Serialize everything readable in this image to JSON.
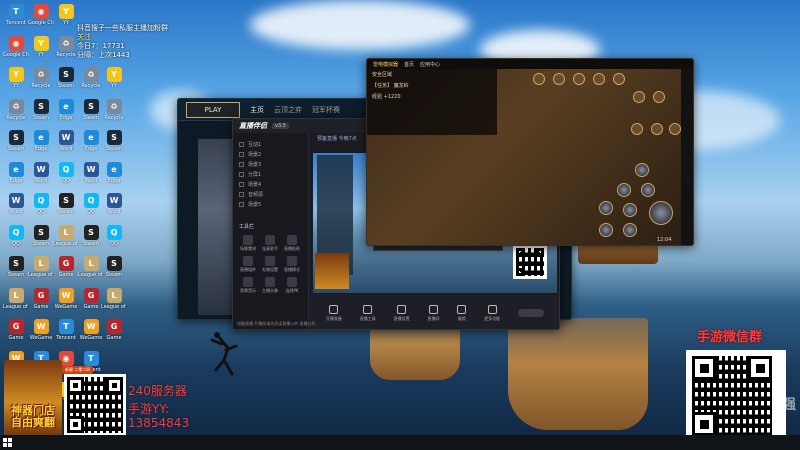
{
  "overlay": {
    "line1": "抖音搜子一些私服主播加粉群",
    "line2": "关注",
    "line3": "分隔：上次1443",
    "line4": "今日7：17731"
  },
  "desktop_icons": [
    {
      "label": "Tencent",
      "color": "#2a8bd8",
      "glyph": "T"
    },
    {
      "label": "Google Chrome",
      "color": "#e24a3b",
      "glyph": "◉"
    },
    {
      "label": "YY",
      "color": "#f5c518",
      "glyph": "Y"
    },
    {
      "label": "Recycle",
      "color": "#7a8a9a",
      "glyph": "♻"
    },
    {
      "label": "Steam",
      "color": "#1b2838",
      "glyph": "S"
    },
    {
      "label": "Edge",
      "color": "#1e8bd8",
      "glyph": "e"
    },
    {
      "label": "Word",
      "color": "#2b579a",
      "glyph": "W"
    },
    {
      "label": "QQ",
      "color": "#12b7f5",
      "glyph": "Q"
    },
    {
      "label": "Steam",
      "color": "#222",
      "glyph": "S"
    },
    {
      "label": "League of Legends",
      "color": "#c8aa6e",
      "glyph": "L"
    },
    {
      "label": "Game",
      "color": "#b8252b",
      "glyph": "G"
    },
    {
      "label": "WeGame",
      "color": "#f0a020",
      "glyph": "W"
    }
  ],
  "lol_window": {
    "play": "PLAY",
    "tabs": [
      "主页",
      "云顶之弈",
      "冠军杯赛"
    ]
  },
  "live_window": {
    "logo": "直播伴侣",
    "version": "v3.5",
    "header": "预备直播  今晚7点",
    "side_items": [
      "互动1",
      "场景2",
      "场景3",
      "分屏1",
      "场景4",
      "音频源",
      "场景5"
    ],
    "tools_title": "工具栏",
    "tools": [
      "场景素材",
      "连麦助手",
      "直播贴纸",
      "直播组件",
      "礼物设置",
      "直播模式",
      "背景音乐",
      "主播头像",
      "连线PK"
    ],
    "bottom": [
      "开播准备",
      "直播工具",
      "直播设置",
      "直播间",
      "美颜",
      "更多功能"
    ],
    "footer": "电脑直播  开播前请先阅读直播公约  直播公约"
  },
  "game_window": {
    "title": "雷电模拟器",
    "tabs": [
      "首页",
      "应用中心"
    ],
    "panel_rows": [
      "安全区域",
      "【任务】 魔龙岭",
      "经验 +1220"
    ],
    "clock": "12:04"
  },
  "promo_left": {
    "banner_title": "神器门店 自由爽翻",
    "tag": "新服 二零二四",
    "server_text": "240服务器",
    "yy_text": "手游YY:",
    "number_text": "13854843"
  },
  "promo_right": {
    "wechat_group": "手游微信群"
  },
  "watermark": "强"
}
